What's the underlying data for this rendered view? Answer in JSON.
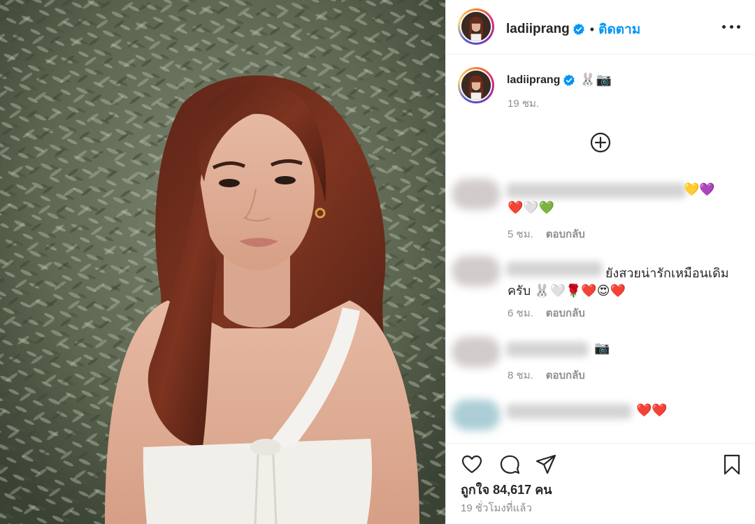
{
  "post": {
    "username": "ladiiprang",
    "follow_label": "ติดตาม",
    "dot": "•",
    "caption_emoji": "🐰📷",
    "caption_time": "19 ชม.",
    "likes_text": "ถูกใจ 84,617 คน",
    "posted_text": "19 ชั่วโมงที่แล้ว"
  },
  "comments": [
    {
      "text_line1": "💛💜",
      "text_line2": "❤️🤍💚",
      "time": "5 ชม.",
      "reply": "ตอบกลับ"
    },
    {
      "text_line1": "ยังสวยน่ารักเหมือนเดิม",
      "text_line2": "ครับ 🐰🤍🌹❤️😍❤️",
      "time": "6 ชม.",
      "reply": "ตอบกลับ"
    },
    {
      "text_line1": "📷",
      "time": "8 ชม.",
      "reply": "ตอบกลับ"
    },
    {
      "text_line1": "❤️❤️"
    }
  ],
  "icons": {
    "more": "more-options-icon",
    "verified": "verified-badge-icon",
    "load_more": "plus-circle-icon",
    "like": "heart-icon",
    "comment": "comment-icon",
    "share": "share-icon",
    "save": "bookmark-icon"
  },
  "colors": {
    "accent": "#0095f6",
    "verified": "#0095f6",
    "muted": "#8e8e8e"
  }
}
